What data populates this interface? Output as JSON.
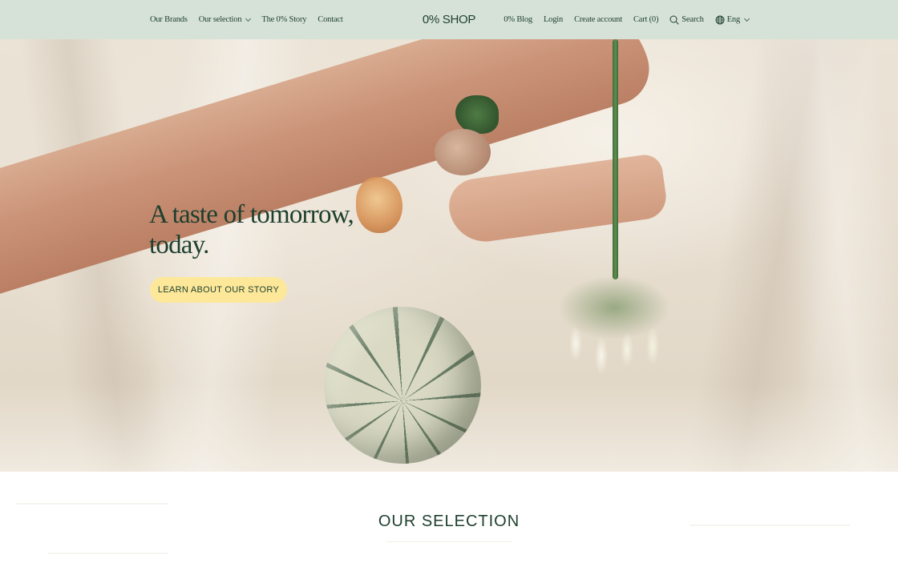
{
  "nav": {
    "left": [
      {
        "label": "Our Brands"
      },
      {
        "label": "Our selection",
        "has_dropdown": true
      },
      {
        "label": "The 0% Story"
      },
      {
        "label": "Contact"
      }
    ],
    "logo": "0% SHOP",
    "right": {
      "blog": "0% Blog",
      "login": "Login",
      "create_account": "Create account",
      "cart": "Cart (0)",
      "search": "Search",
      "language": "Eng"
    },
    "icons": {
      "search": "search-icon",
      "language": "globe-icon",
      "dropdown": "chevron-down-icon"
    }
  },
  "hero": {
    "title": "A taste of tomorrow, today.",
    "button": "LEARN ABOUT OUR STORY"
  },
  "selection": {
    "title": "OUR SELECTION"
  },
  "colors": {
    "nav_bg": "#d6e2d8",
    "brand_green": "#1d3f2e",
    "button_yellow": "#fde89a"
  }
}
